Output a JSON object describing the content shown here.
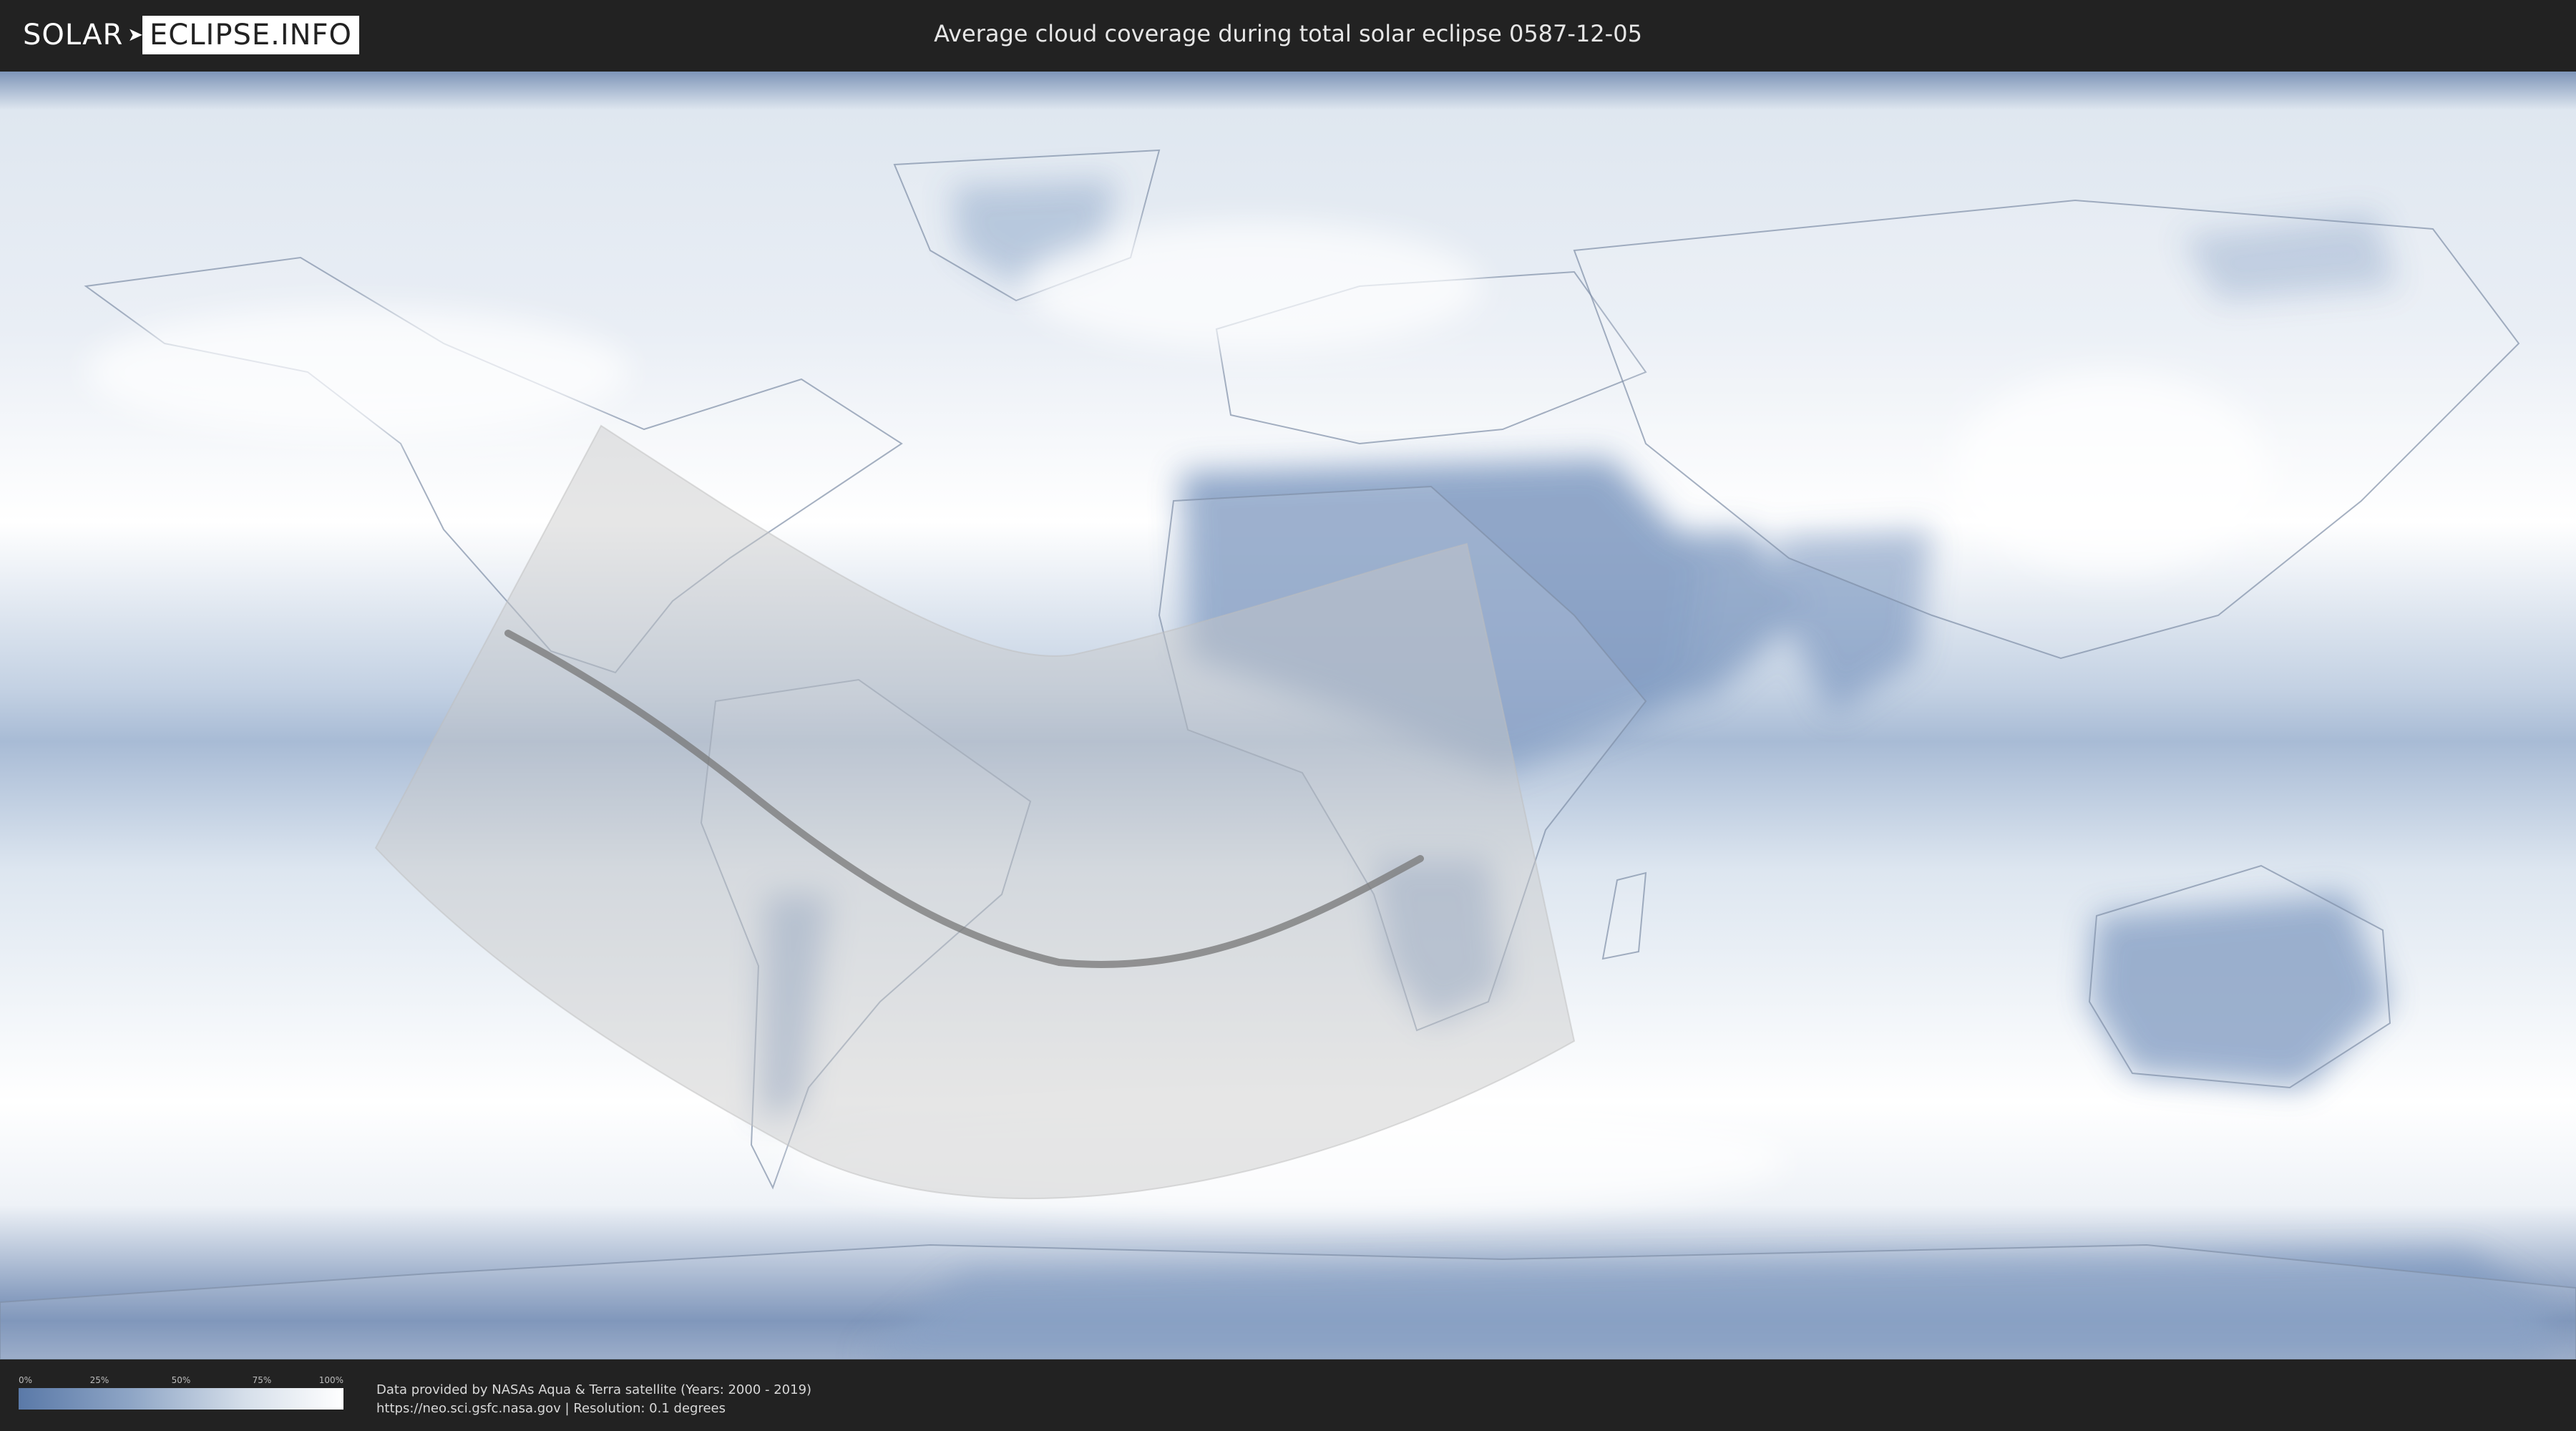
{
  "header": {
    "logo": {
      "left": "SOLAR",
      "right": "ECLIPSE.INFO"
    },
    "title": "Average cloud coverage during total solar eclipse 0587-12-05"
  },
  "map": {
    "colors": {
      "clear": "#5a79a8",
      "cloudy": "#ffffff",
      "eclipse_overlay": "#c8c8c8",
      "central_line": "#777777"
    }
  },
  "footer": {
    "legend": {
      "ticks": [
        "0%",
        "25%",
        "50%",
        "75%",
        "100%"
      ]
    },
    "credits": {
      "line1": "Data provided by NASAs Aqua & Terra satellite (Years: 2000 - 2019)",
      "line2": "https://neo.sci.gsfc.nasa.gov | Resolution: 0.1 degrees"
    }
  }
}
